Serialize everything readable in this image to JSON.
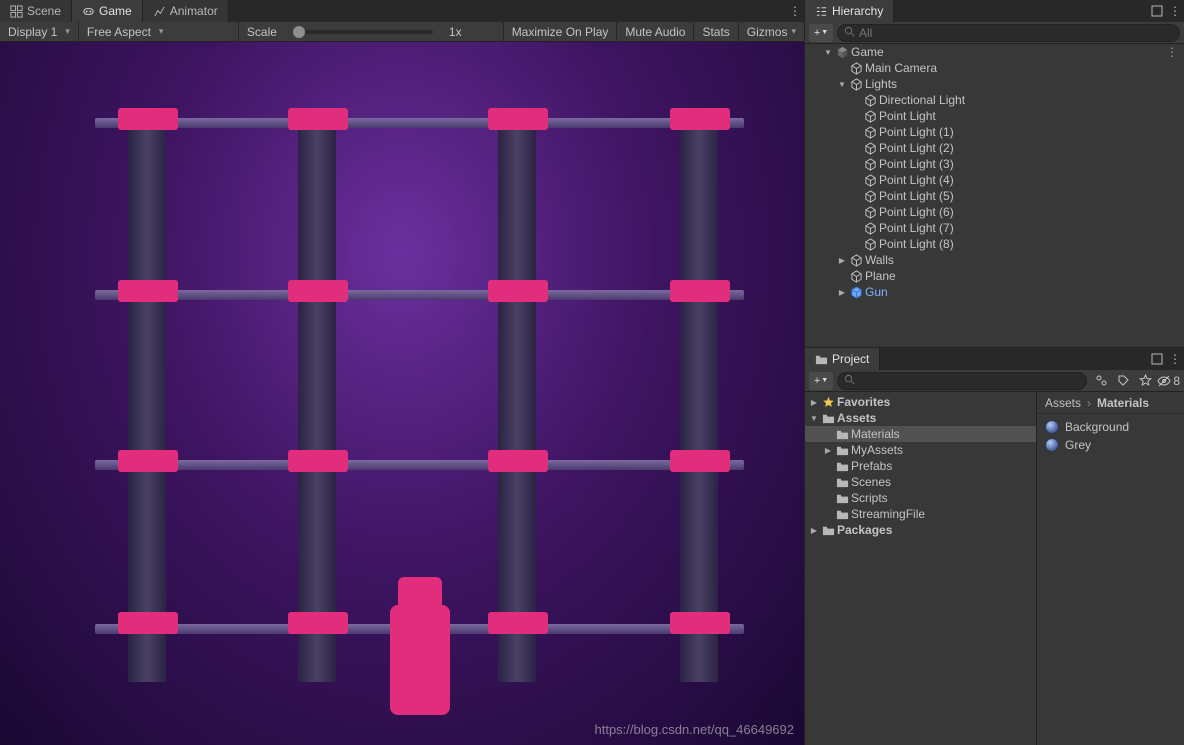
{
  "tabs_main": [
    {
      "label": "Scene",
      "icon": "scene"
    },
    {
      "label": "Game",
      "icon": "game"
    },
    {
      "label": "Animator",
      "icon": "animator"
    }
  ],
  "active_main_tab": 1,
  "game_toolbar": {
    "display": "Display 1",
    "aspect": "Free Aspect",
    "scale_label": "Scale",
    "scale_value": "1x",
    "maximize": "Maximize On Play",
    "mute": "Mute Audio",
    "stats": "Stats",
    "gizmos": "Gizmos"
  },
  "hierarchy": {
    "tab_label": "Hierarchy",
    "search_placeholder": "All",
    "root": {
      "label": "Game",
      "children": [
        {
          "label": "Main Camera",
          "icon": "cube"
        },
        {
          "label": "Lights",
          "icon": "cube",
          "open": true,
          "children": [
            {
              "label": "Directional Light"
            },
            {
              "label": "Point Light"
            },
            {
              "label": "Point Light (1)"
            },
            {
              "label": "Point Light (2)"
            },
            {
              "label": "Point Light (3)"
            },
            {
              "label": "Point Light (4)"
            },
            {
              "label": "Point Light (5)"
            },
            {
              "label": "Point Light (6)"
            },
            {
              "label": "Point Light (7)"
            },
            {
              "label": "Point Light (8)"
            }
          ]
        },
        {
          "label": "Walls",
          "icon": "cube",
          "closed": true
        },
        {
          "label": "Plane",
          "icon": "cube"
        },
        {
          "label": "Gun",
          "icon": "prefab",
          "prefab": true,
          "closed": true
        }
      ]
    }
  },
  "project": {
    "tab_label": "Project",
    "hidden_count": "8",
    "tree": [
      {
        "label": "Favorites",
        "icon": "star",
        "closed": true,
        "depth": 0
      },
      {
        "label": "Assets",
        "icon": "folder",
        "open": true,
        "depth": 0
      },
      {
        "label": "Materials",
        "icon": "folder",
        "depth": 1,
        "selected": true
      },
      {
        "label": "MyAssets",
        "icon": "folder",
        "depth": 1,
        "closed": true
      },
      {
        "label": "Prefabs",
        "icon": "folder",
        "depth": 1
      },
      {
        "label": "Scenes",
        "icon": "folder",
        "depth": 1
      },
      {
        "label": "Scripts",
        "icon": "folder",
        "depth": 1
      },
      {
        "label": "StreamingFile",
        "icon": "folder",
        "depth": 1
      },
      {
        "label": "Packages",
        "icon": "folder",
        "closed": true,
        "depth": 0
      }
    ],
    "breadcrumb": [
      "Assets",
      "Materials"
    ],
    "assets": [
      {
        "label": "Background",
        "icon": "material"
      },
      {
        "label": "Grey",
        "icon": "material"
      }
    ]
  },
  "watermark": "https://blog.csdn.net/qq_46649692"
}
